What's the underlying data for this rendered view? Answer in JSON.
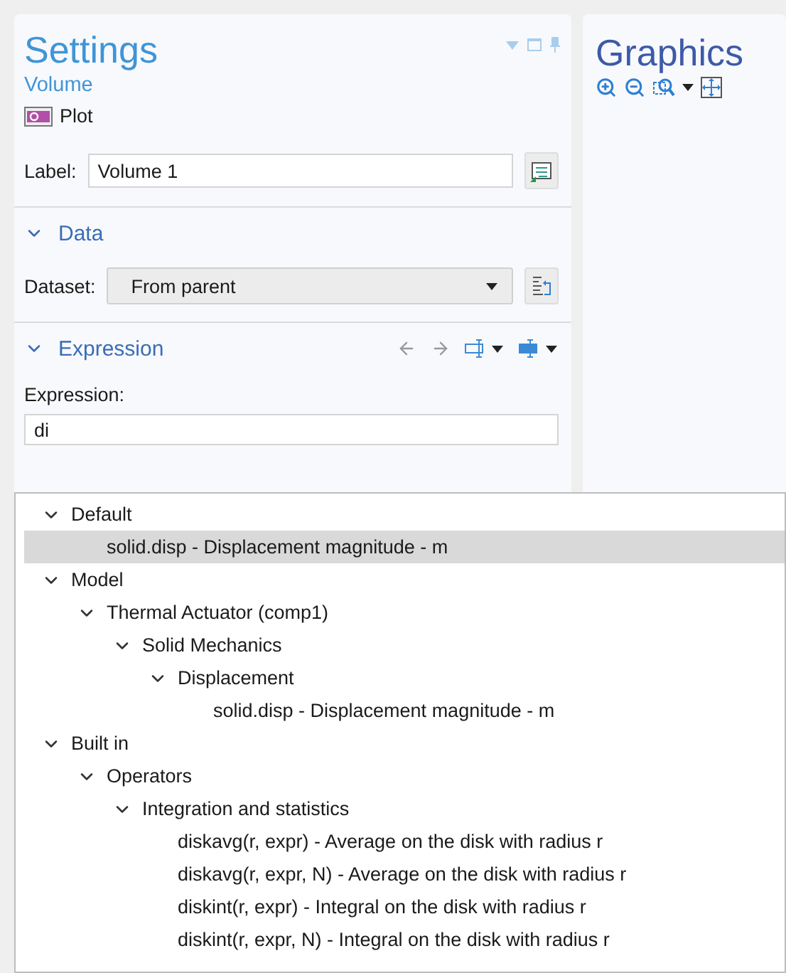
{
  "settings": {
    "title": "Settings",
    "subtitle": "Volume",
    "node_type": "Plot",
    "label_row": {
      "label": "Label:",
      "value": "Volume 1"
    },
    "data_section": {
      "title": "Data",
      "expanded": true,
      "dataset_label": "Dataset:",
      "dataset_value": "From parent"
    },
    "expression_section": {
      "title": "Expression",
      "expanded": true,
      "field_label": "Expression:",
      "value": "di"
    }
  },
  "graphics": {
    "title": "Graphics"
  },
  "suggestions": [
    {
      "label": "Default",
      "expanded": true,
      "selected": false,
      "children": [
        {
          "label": "solid.disp - Displacement magnitude - m",
          "selected": true
        }
      ]
    },
    {
      "label": "Model",
      "expanded": true,
      "selected": false,
      "children": [
        {
          "label": "Thermal Actuator (comp1)",
          "expanded": true,
          "selected": false,
          "children": [
            {
              "label": "Solid Mechanics",
              "expanded": true,
              "selected": false,
              "children": [
                {
                  "label": "Displacement",
                  "expanded": true,
                  "selected": false,
                  "children": [
                    {
                      "label": "solid.disp - Displacement magnitude - m",
                      "selected": false
                    }
                  ]
                }
              ]
            }
          ]
        }
      ]
    },
    {
      "label": "Built in",
      "expanded": true,
      "selected": false,
      "children": [
        {
          "label": "Operators",
          "expanded": true,
          "selected": false,
          "children": [
            {
              "label": "Integration and statistics",
              "expanded": true,
              "selected": false,
              "children": [
                {
                  "label": "diskavg(r, expr) - Average on the disk with radius r",
                  "selected": false
                },
                {
                  "label": "diskavg(r, expr, N) - Average on the disk with radius r",
                  "selected": false
                },
                {
                  "label": "diskint(r, expr) - Integral on the disk with radius r",
                  "selected": false
                },
                {
                  "label": "diskint(r, expr, N) - Integral on the disk with radius r",
                  "selected": false
                }
              ]
            }
          ]
        }
      ]
    }
  ]
}
